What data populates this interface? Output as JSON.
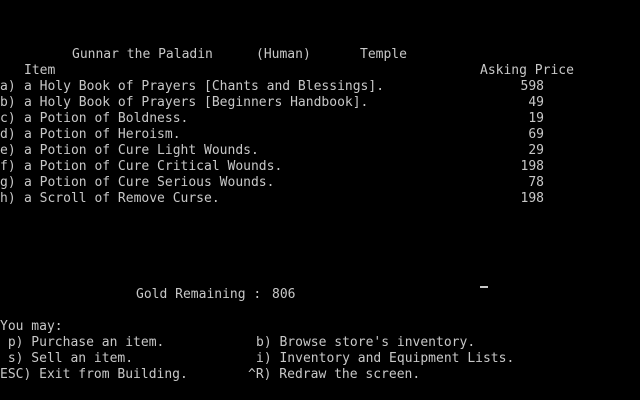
{
  "header": {
    "character": "Gunnar the Paladin",
    "race": "(Human)",
    "store_name": "Temple"
  },
  "columns": {
    "item": "Item",
    "price": "Asking Price"
  },
  "items": [
    {
      "key": "a)",
      "name": "a Holy Book of Prayers [Chants and Blessings].",
      "price": "598"
    },
    {
      "key": "b)",
      "name": "a Holy Book of Prayers [Beginners Handbook].",
      "price": "49"
    },
    {
      "key": "c)",
      "name": "a Potion of Boldness.",
      "price": "19"
    },
    {
      "key": "d)",
      "name": "a Potion of Heroism.",
      "price": "69"
    },
    {
      "key": "e)",
      "name": "a Potion of Cure Light Wounds.",
      "price": "29"
    },
    {
      "key": "f)",
      "name": "a Potion of Cure Critical Wounds.",
      "price": "198"
    },
    {
      "key": "g)",
      "name": "a Potion of Cure Serious Wounds.",
      "price": "78"
    },
    {
      "key": "h)",
      "name": "a Scroll of Remove Curse.",
      "price": "198"
    }
  ],
  "gold": {
    "label": "Gold Remaining :",
    "value": "806"
  },
  "commands": {
    "prompt": "You may:",
    "purchase": " p) Purchase an item.",
    "browse": "b) Browse store's inventory.",
    "sell": " s) Sell an item.",
    "inventory": "i) Inventory and Equipment Lists.",
    "exit": "ESC) Exit from Building.",
    "redraw": "^R) Redraw the screen."
  }
}
